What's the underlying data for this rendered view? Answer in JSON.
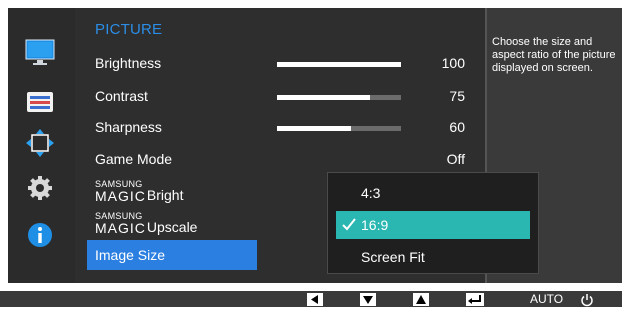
{
  "menu": {
    "title": "PICTURE",
    "rows": [
      {
        "label": "Brightness",
        "value": "100",
        "level": 100
      },
      {
        "label": "Contrast",
        "value": "75",
        "level": 75
      },
      {
        "label": "Sharpness",
        "value": "60",
        "level": 60
      },
      {
        "label": "Game Mode",
        "value": "Off"
      },
      {
        "brand_small": "SAMSUNG",
        "brand_big": "MAGIC",
        "label": "Bright"
      },
      {
        "brand_small": "SAMSUNG",
        "brand_big": "MAGIC",
        "label": "Upscale"
      },
      {
        "label": "Image Size"
      }
    ]
  },
  "dropdown": {
    "options": [
      "4:3",
      "16:9",
      "Screen Fit"
    ],
    "selected": "16:9"
  },
  "description": "Choose the size and aspect ratio of the picture displayed on screen.",
  "bottom": {
    "auto_label": "AUTO"
  },
  "colors": {
    "accent_blue": "#2b7fe0",
    "title_blue": "#2b8de6",
    "selection_teal": "#2ab7b2"
  },
  "icons": {
    "left_nav": [
      "monitor-icon",
      "menu-list-icon",
      "resize-arrows-icon",
      "gear-icon",
      "info-icon"
    ],
    "bottom_buttons": [
      "left-arrow-icon",
      "down-arrow-icon",
      "up-arrow-icon",
      "enter-icon",
      "power-icon"
    ]
  }
}
